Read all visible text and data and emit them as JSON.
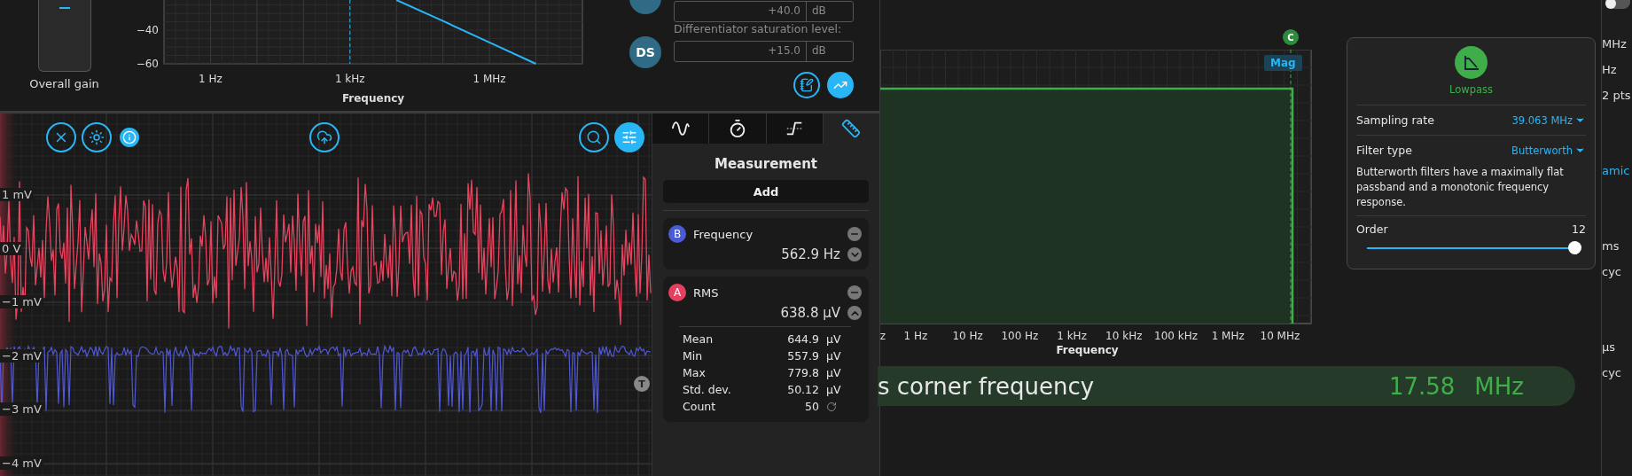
{
  "gain": {
    "label": "Overall gain",
    "level": 0.9
  },
  "bode": {
    "chart_data": {
      "type": "line",
      "xlabel": "Frequency",
      "categories": [
        null,
        "1 Hz",
        null,
        null,
        "1 kHz",
        null,
        null,
        "1 MHz",
        null,
        null
      ],
      "ylim": [
        -60,
        -22
      ],
      "yticks": [
        -40,
        -60
      ],
      "grid": true,
      "values": [
        null,
        null,
        null,
        null,
        null,
        -22,
        -34.5,
        -47.3,
        -60,
        null
      ]
    }
  },
  "settings": {
    "top_field": {
      "value": "+40.0",
      "unit": "dB"
    },
    "saturation": {
      "badge": "DS",
      "label": "Differentiator saturation level:",
      "value": "+15.0",
      "unit": "dB"
    }
  },
  "scope": {
    "y_labels": [
      "1 mV",
      "0 V",
      "−1 mV",
      "−2 mV",
      "−3 mV",
      "−4 mV"
    ],
    "trigger_label": "T"
  },
  "measurement": {
    "tabs": [
      {
        "kind": "sine",
        "selected": false
      },
      {
        "kind": "timer",
        "selected": false
      },
      {
        "kind": "edge",
        "selected": false
      },
      {
        "kind": "ruler",
        "selected": true
      }
    ],
    "title": "Measurement",
    "add_button": "Add",
    "cards": [
      {
        "channel": "B",
        "color": "#4b5bd6",
        "name": "Frequency",
        "value": "562.9 Hz",
        "expanded": false
      },
      {
        "channel": "A",
        "color": "#e5405e",
        "name": "RMS",
        "value": "638.8 µV",
        "expanded": true,
        "stats": [
          {
            "kind": "value",
            "label": "Mean",
            "value": "644.9",
            "unit": "µV"
          },
          {
            "kind": "value",
            "label": "Min",
            "value": "557.9",
            "unit": "µV"
          },
          {
            "kind": "value",
            "label": "Max",
            "value": "779.8",
            "unit": "µV"
          },
          {
            "kind": "value",
            "label": "Std. dev.",
            "value": "50.12",
            "unit": "µV"
          },
          {
            "kind": "count",
            "label": "Count",
            "value": "50"
          }
        ]
      }
    ]
  },
  "filter_chart": {
    "marker": "C",
    "badge": "Mag",
    "x_labels": [
      "z",
      "1 Hz",
      "10 Hz",
      "100 Hz",
      "1 kHz",
      "10 kHz",
      "100 kHz",
      "1 MHz",
      "10 MHz"
    ],
    "xlabel": "Frequency"
  },
  "filter_card": {
    "type": "Lowpass",
    "rows": [
      {
        "label": "Sampling rate",
        "value": "39.063 MHz"
      },
      {
        "label": "Filter type",
        "value": "Butterworth"
      }
    ],
    "description": "Butterworth filters have a maximally flat passband and a monotonic frequency response.",
    "order": {
      "label": "Order",
      "value": "12",
      "level": 1
    }
  },
  "corner": {
    "label": "s corner frequency",
    "value": "17.58",
    "unit": "MHz"
  },
  "sidebar": {
    "toggle_on": false,
    "sections": [
      [
        {
          "text": "MHz",
          "kind": "unit"
        },
        {
          "text": "Hz",
          "kind": "unit"
        },
        {
          "text": "2 pts",
          "kind": "unit"
        }
      ],
      [
        {
          "text": "amic",
          "kind": "accent"
        }
      ],
      [
        {
          "text": "ms",
          "kind": "unit"
        },
        {
          "text": "cyc",
          "kind": "unit"
        }
      ],
      [
        {
          "text": "µs",
          "kind": "unit"
        },
        {
          "text": "cyc",
          "kind": "unit"
        }
      ]
    ]
  }
}
